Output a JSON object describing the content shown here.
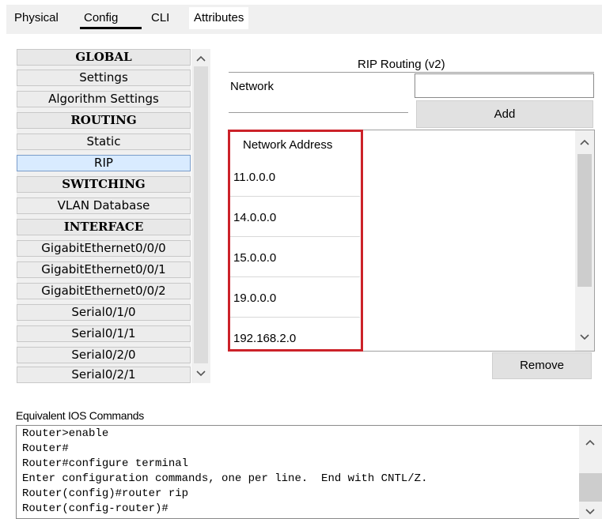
{
  "tabs": [
    {
      "label": "Physical"
    },
    {
      "label": "Config"
    },
    {
      "label": "CLI"
    },
    {
      "label": "Attributes"
    }
  ],
  "menu": {
    "items": [
      {
        "label": "GLOBAL"
      },
      {
        "label": "Settings"
      },
      {
        "label": "Algorithm Settings"
      },
      {
        "label": "ROUTING"
      },
      {
        "label": "Static"
      },
      {
        "label": "RIP"
      },
      {
        "label": "SWITCHING"
      },
      {
        "label": "VLAN Database"
      },
      {
        "label": "INTERFACE"
      },
      {
        "label": "GigabitEthernet0/0/0"
      },
      {
        "label": "GigabitEthernet0/0/1"
      },
      {
        "label": "GigabitEthernet0/0/2"
      },
      {
        "label": "Serial0/1/0"
      },
      {
        "label": "Serial0/1/1"
      },
      {
        "label": "Serial0/2/0"
      },
      {
        "label": "Serial0/2/1"
      }
    ],
    "selected": "RIP"
  },
  "rip": {
    "title": "RIP Routing (v2)",
    "network_label": "Network",
    "network_value": "",
    "add_label": "Add",
    "remove_label": "Remove",
    "list_header": "Network Address",
    "addresses": [
      "11.0.0.0",
      "14.0.0.0",
      "15.0.0.0",
      "19.0.0.0",
      "192.168.2.0"
    ]
  },
  "ios": {
    "label": "Equivalent IOS Commands",
    "lines": [
      "Router>enable",
      "Router#",
      "Router#configure terminal",
      "Enter configuration commands, one per line.  End with CNTL/Z.",
      "Router(config)#router rip",
      "Router(config-router)#"
    ]
  },
  "icons": {
    "up": "▲",
    "down": "▼",
    "chevron_up": "^",
    "chevron_down": "v"
  },
  "colors": {
    "highlight_border": "#cc2229",
    "selected_item": "#d9ebff"
  }
}
